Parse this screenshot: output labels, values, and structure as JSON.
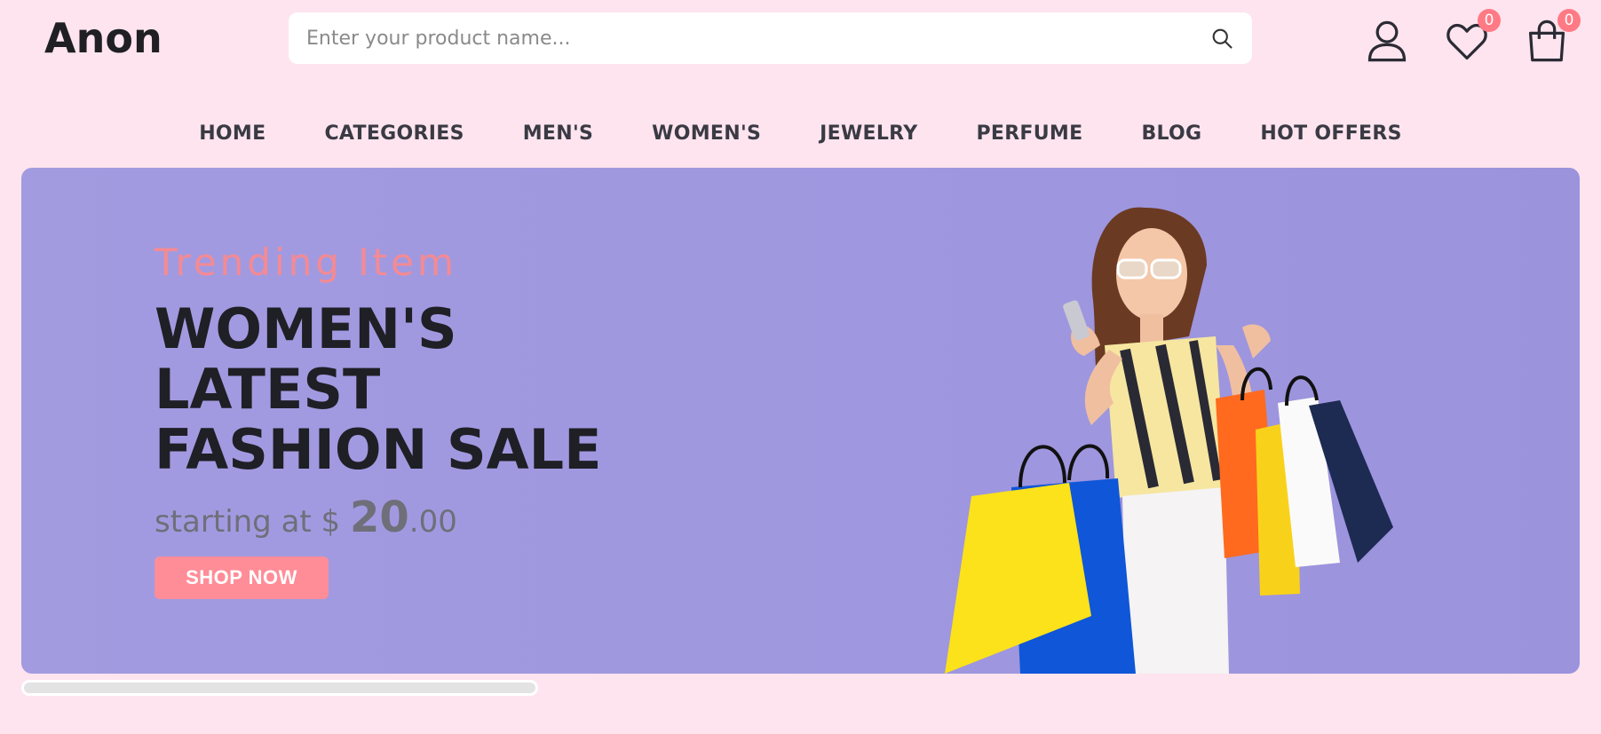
{
  "header": {
    "logo": "Anon",
    "search": {
      "placeholder": "Enter your product name..."
    },
    "wishlist_count": "0",
    "cart_count": "0"
  },
  "nav": {
    "items": [
      "HOME",
      "CATEGORIES",
      "MEN'S",
      "WOMEN'S",
      "JEWELRY",
      "PERFUME",
      "BLOG",
      "HOT OFFERS"
    ]
  },
  "banner": {
    "subtitle": "Trending Item",
    "title_line1": "WOMEN'S",
    "title_line2": "LATEST",
    "title_line3": "FASHION SALE",
    "price_prefix": "starting at $ ",
    "price_whole": "20",
    "price_cents": ".00",
    "button_label": "SHOP NOW"
  },
  "colors": {
    "background": "#fde4ee",
    "banner": "#a39be0",
    "accent": "#ff8d98",
    "badge": "#ff7a85"
  },
  "icons": [
    "search-icon",
    "user-icon",
    "heart-icon",
    "shopping-bag-icon"
  ]
}
